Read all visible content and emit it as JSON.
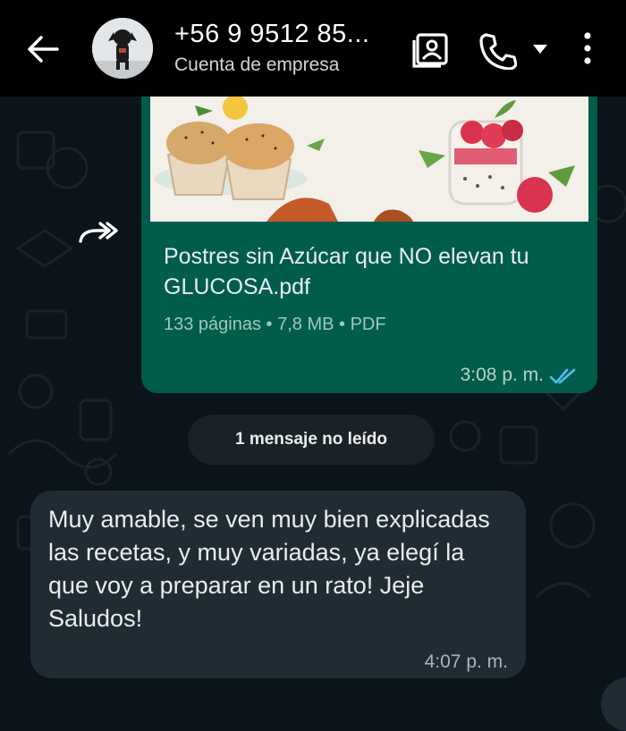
{
  "header": {
    "title": "+56 9 9512 85...",
    "subtitle": "Cuenta de empresa",
    "icons": [
      "back-arrow-icon",
      "contact-card-icon",
      "phone-icon",
      "caret-down-icon",
      "more-vert-icon"
    ]
  },
  "messages": {
    "document": {
      "file_name": "Postres sin Azúcar que NO elevan tu GLUCOSA.pdf",
      "meta": "133 páginas • 7,8 MB • PDF",
      "time": "3:08 p. m.",
      "status": "read"
    },
    "unread_banner": "1 mensaje no leído",
    "received": {
      "text": "Muy amable, se ven muy bien explicadas las recetas, y muy variadas, ya elegí la que voy a preparar en un rato! Jeje Saludos!",
      "time": "4:07 p. m."
    }
  },
  "colors": {
    "header_bg": "#000000",
    "chat_bg": "#0b141a",
    "outgoing_bubble": "#005c4b",
    "incoming_bubble": "#202c33",
    "read_ticks": "#53bdeb"
  }
}
